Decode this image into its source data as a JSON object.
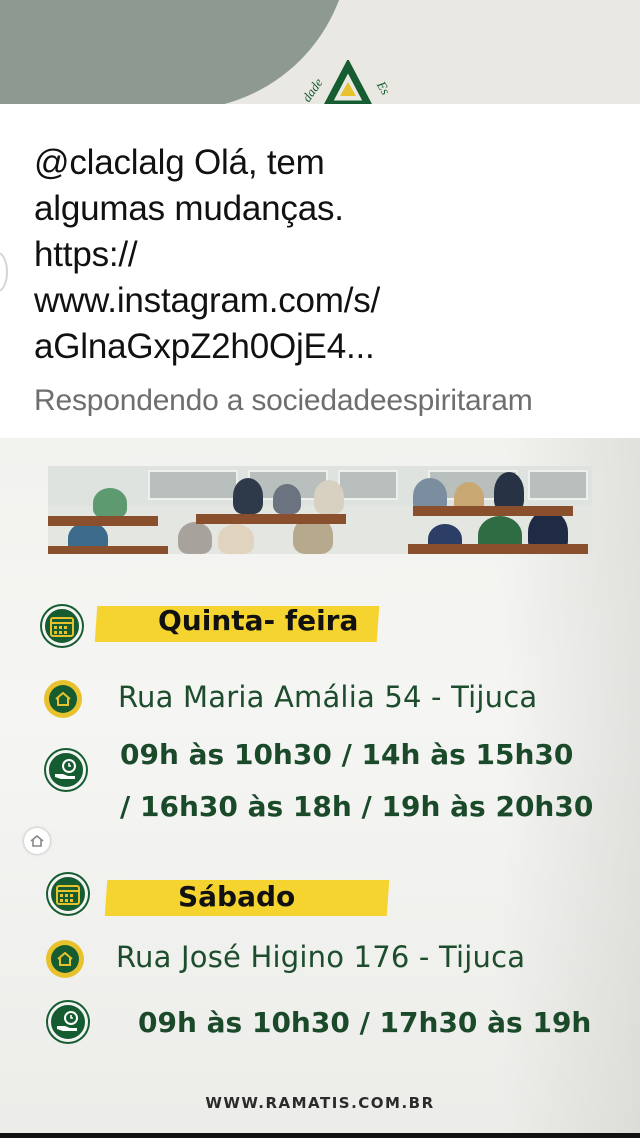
{
  "reply": {
    "lines": [
      "@claclalg Olá, tem",
      "algumas mudanças.",
      "https://",
      "www.instagram.com/s/",
      "aGlnaGxpZ2h0OjE4..."
    ],
    "footer": "Respondendo a sociedadeespiritaram"
  },
  "post": {
    "thursday": {
      "day": "Quinta- feira",
      "address": "Rua Maria Amália 54  - Tijuca",
      "hours_line1": "09h às 10h30  /   14h às 15h30",
      "hours_line2": "/  16h30 às 18h  / 19h às 20h30"
    },
    "saturday": {
      "day": "Sábado",
      "address": "Rua José Higino 176  - Tijuca",
      "hours": "09h às 10h30 /  17h30 às 19h"
    },
    "website": "WWW.RAMATIS.COM.BR"
  },
  "icons": {
    "calendar": "calendar-icon",
    "home": "home-icon",
    "hand_clock": "hand-clock-icon"
  },
  "colors": {
    "brand_green": "#155c31",
    "highlight_yellow": "#f6d42f",
    "text_green": "#1d4d2c"
  }
}
